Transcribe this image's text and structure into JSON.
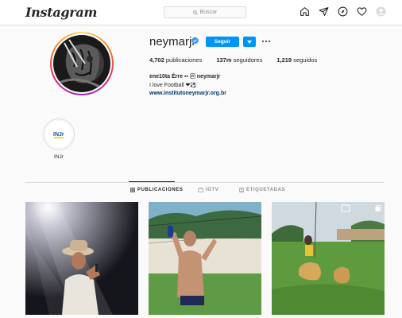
{
  "header": {
    "logo_text": "Instagram",
    "search_placeholder": "Buscar",
    "nav_icons": [
      "home-icon",
      "direct-send-icon",
      "explore-compass-icon",
      "heart-activity-icon",
      "profile-avatar-icon"
    ]
  },
  "profile": {
    "username": "neymarjr",
    "verified": true,
    "follow_label": "Seguir",
    "stats": {
      "posts_value": "4,702",
      "posts_label": "publicaciones",
      "followers_value": "137m",
      "followers_label": "seguidores",
      "following_value": "1,219",
      "following_label": "seguidos"
    },
    "bio": {
      "name_line": "ene10ta Érre ▪▪ ⓝ neymarjr",
      "text": "I love Football ❤⚽",
      "link": "www.institutoneymarjr.org.br"
    }
  },
  "highlights": [
    {
      "label": "INJr"
    }
  ],
  "tabs": [
    {
      "label": "PUBLICACIONES",
      "active": true,
      "icon": "grid-icon"
    },
    {
      "label": "IGTV",
      "active": false,
      "icon": "igtv-icon"
    },
    {
      "label": "ETIQUETADAS",
      "active": false,
      "icon": "tagged-icon"
    }
  ],
  "colors": {
    "accent": "#0095f6",
    "link": "#00376b",
    "border": "#dbdbdb",
    "background": "#fafafa"
  }
}
